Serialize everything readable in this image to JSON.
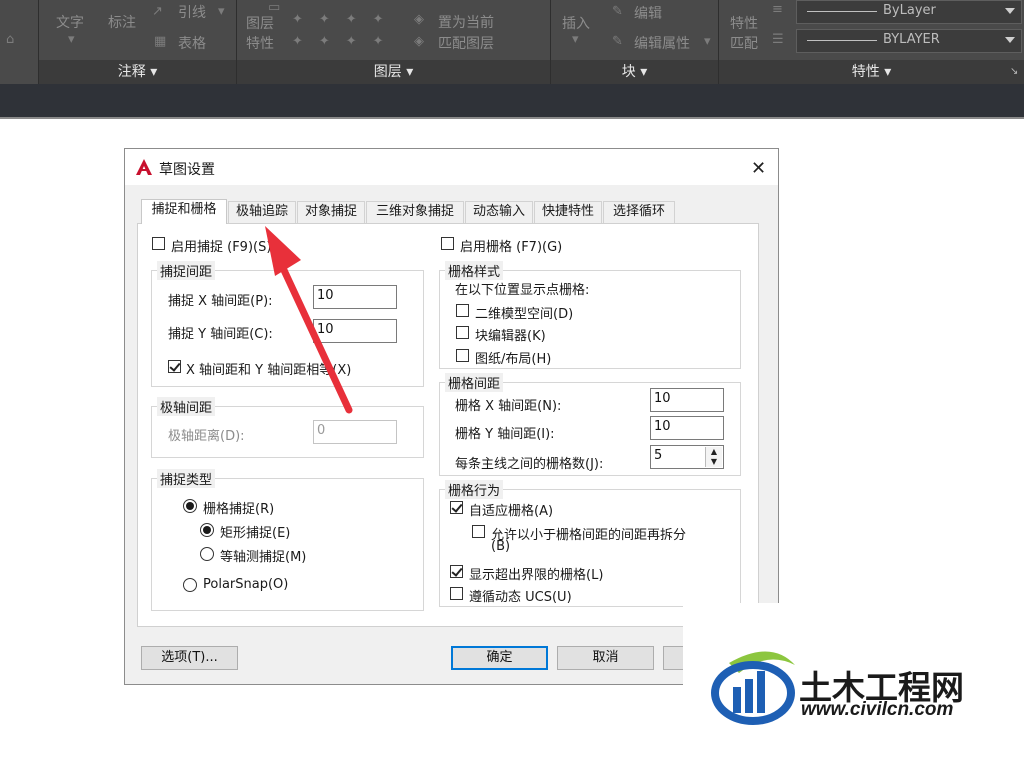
{
  "ribbon": {
    "annotate": {
      "text": "文字",
      "dim": "标注",
      "leader": "引线",
      "table": "表格",
      "title": "注释 ▾"
    },
    "layers": {
      "layer_label": "图层",
      "props_label": "特性",
      "set_current": "置为当前",
      "match_layer": "匹配图层",
      "title": "图层 ▾"
    },
    "block": {
      "insert": "插入",
      "edit": "编辑",
      "edit_attr": "编辑属性",
      "title": "块 ▾"
    },
    "properties": {
      "props_label": "特性",
      "match_label": "匹配",
      "combo1": "ByLayer",
      "combo2": "BYLAYER",
      "title": "特性 ▾"
    }
  },
  "dialog": {
    "title": "草图设置",
    "tabs": [
      "捕捉和栅格",
      "极轴追踪",
      "对象捕捉",
      "三维对象捕捉",
      "动态输入",
      "快捷特性",
      "选择循环"
    ],
    "snap": {
      "enable_label": "启用捕捉 (F9)(S)",
      "enable_checked": false,
      "spacing_group": "捕捉间距",
      "x_label": "捕捉 X 轴间距(P):",
      "x_value": "10",
      "y_label": "捕捉 Y 轴间距(C):",
      "y_value": "10",
      "equal_label": "X 轴间距和 Y 轴间距相等(X)",
      "equal_checked": true,
      "polar_group": "极轴间距",
      "polar_label": "极轴距离(D):",
      "polar_value": "0",
      "type_group": "捕捉类型",
      "grid_snap": "栅格捕捉(R)",
      "rect_snap": "矩形捕捉(E)",
      "iso_snap": "等轴测捕捉(M)",
      "polar_snap": "PolarSnap(O)"
    },
    "grid": {
      "enable_label": "启用栅格 (F7)(G)",
      "enable_checked": false,
      "style_group": "栅格样式",
      "style_desc": "在以下位置显示点栅格:",
      "model_space": "二维模型空间(D)",
      "block_editor": "块编辑器(K)",
      "sheet_layout": "图纸/布局(H)",
      "spacing_group": "栅格间距",
      "x_label": "栅格 X 轴间距(N):",
      "x_value": "10",
      "y_label": "栅格 Y 轴间距(I):",
      "y_value": "10",
      "major_label": "每条主线之间的栅格数(J):",
      "major_value": "5",
      "behavior_group": "栅格行为",
      "adaptive": "自适应栅格(A)",
      "adaptive_checked": true,
      "subdivide_line1": "允许以小于栅格间距的间距再拆分",
      "subdivide_line2": "(B)",
      "subdivide_checked": false,
      "beyond_limits": "显示超出界限的栅格(L)",
      "beyond_checked": true,
      "follow_ucs": "遵循动态 UCS(U)",
      "follow_checked": false
    },
    "buttons": {
      "options": "选项(T)...",
      "ok": "确定",
      "cancel": "取消"
    }
  },
  "watermark": {
    "brand": "土木工程网",
    "url": "www.civilcn.com"
  },
  "colors": {
    "ribbon_bg": "#4a4a4a",
    "dialog_bg": "#f0f0f0",
    "arrow": "#e8303a",
    "logo_blue": "#1e5fb4",
    "logo_green": "#8cc63f"
  }
}
